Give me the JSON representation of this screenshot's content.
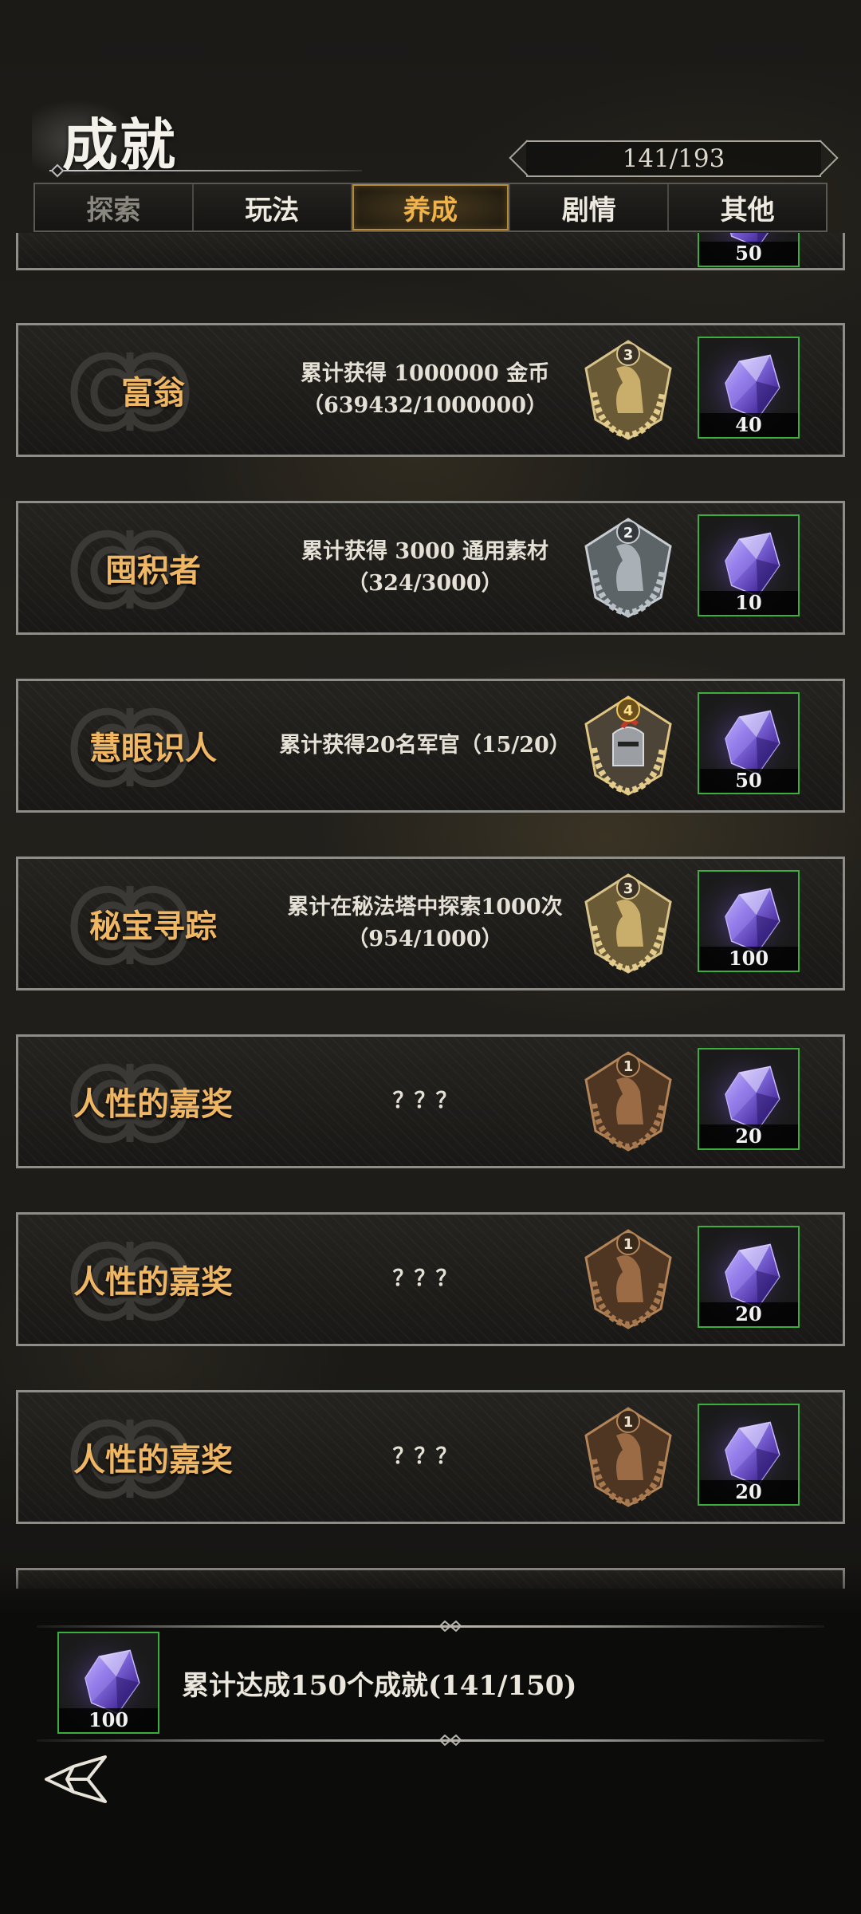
{
  "header": {
    "title": "成就",
    "progress": "141/193"
  },
  "tabs": [
    {
      "label": "探索",
      "state": "dim"
    },
    {
      "label": "玩法",
      "state": "normal"
    },
    {
      "label": "养成",
      "state": "active"
    },
    {
      "label": "剧情",
      "state": "normal"
    },
    {
      "label": "其他",
      "state": "normal"
    }
  ],
  "top_partial_reward": "50",
  "achievements": [
    {
      "name": "富翁",
      "desc1": "累计获得 1000000 金币",
      "desc2": "（639432/1000000）",
      "badge_tier": "3",
      "badge_type": "gold-horse",
      "reward": "40"
    },
    {
      "name": "囤积者",
      "desc1": "累计获得 3000 通用素材",
      "desc2": "（324/3000）",
      "badge_tier": "2",
      "badge_type": "silver-horse",
      "reward": "10"
    },
    {
      "name": "慧眼识人",
      "desc1": "累计获得20名军官（15/20）",
      "desc2": "",
      "badge_tier": "4",
      "badge_type": "gold-knight",
      "reward": "50"
    },
    {
      "name": "秘宝寻踪",
      "desc1": "累计在秘法塔中探索1000次",
      "desc2": "（954/1000）",
      "badge_tier": "3",
      "badge_type": "gold-horse",
      "reward": "100"
    },
    {
      "name": "人性的嘉奖",
      "desc1": "？？？",
      "desc2": "",
      "badge_tier": "1",
      "badge_type": "bronze-horse",
      "reward": "20"
    },
    {
      "name": "人性的嘉奖",
      "desc1": "？？？",
      "desc2": "",
      "badge_tier": "1",
      "badge_type": "bronze-horse",
      "reward": "20"
    },
    {
      "name": "人性的嘉奖",
      "desc1": "？？？",
      "desc2": "",
      "badge_tier": "1",
      "badge_type": "bronze-horse",
      "reward": "20"
    }
  ],
  "total": {
    "label": "累计达成150个成就(141/150)",
    "reward": "100"
  },
  "colors": {
    "accent_gold": "#efb664",
    "reward_border": "#3cae3c",
    "tier_gold": "#c9ad6a",
    "tier_silver": "#a9b0b6",
    "tier_bronze": "#9a6b45"
  },
  "icons": {
    "reward": "crystal-gem-icon",
    "back": "back-arrow-icon",
    "badge": "laurel-medal-icon"
  }
}
